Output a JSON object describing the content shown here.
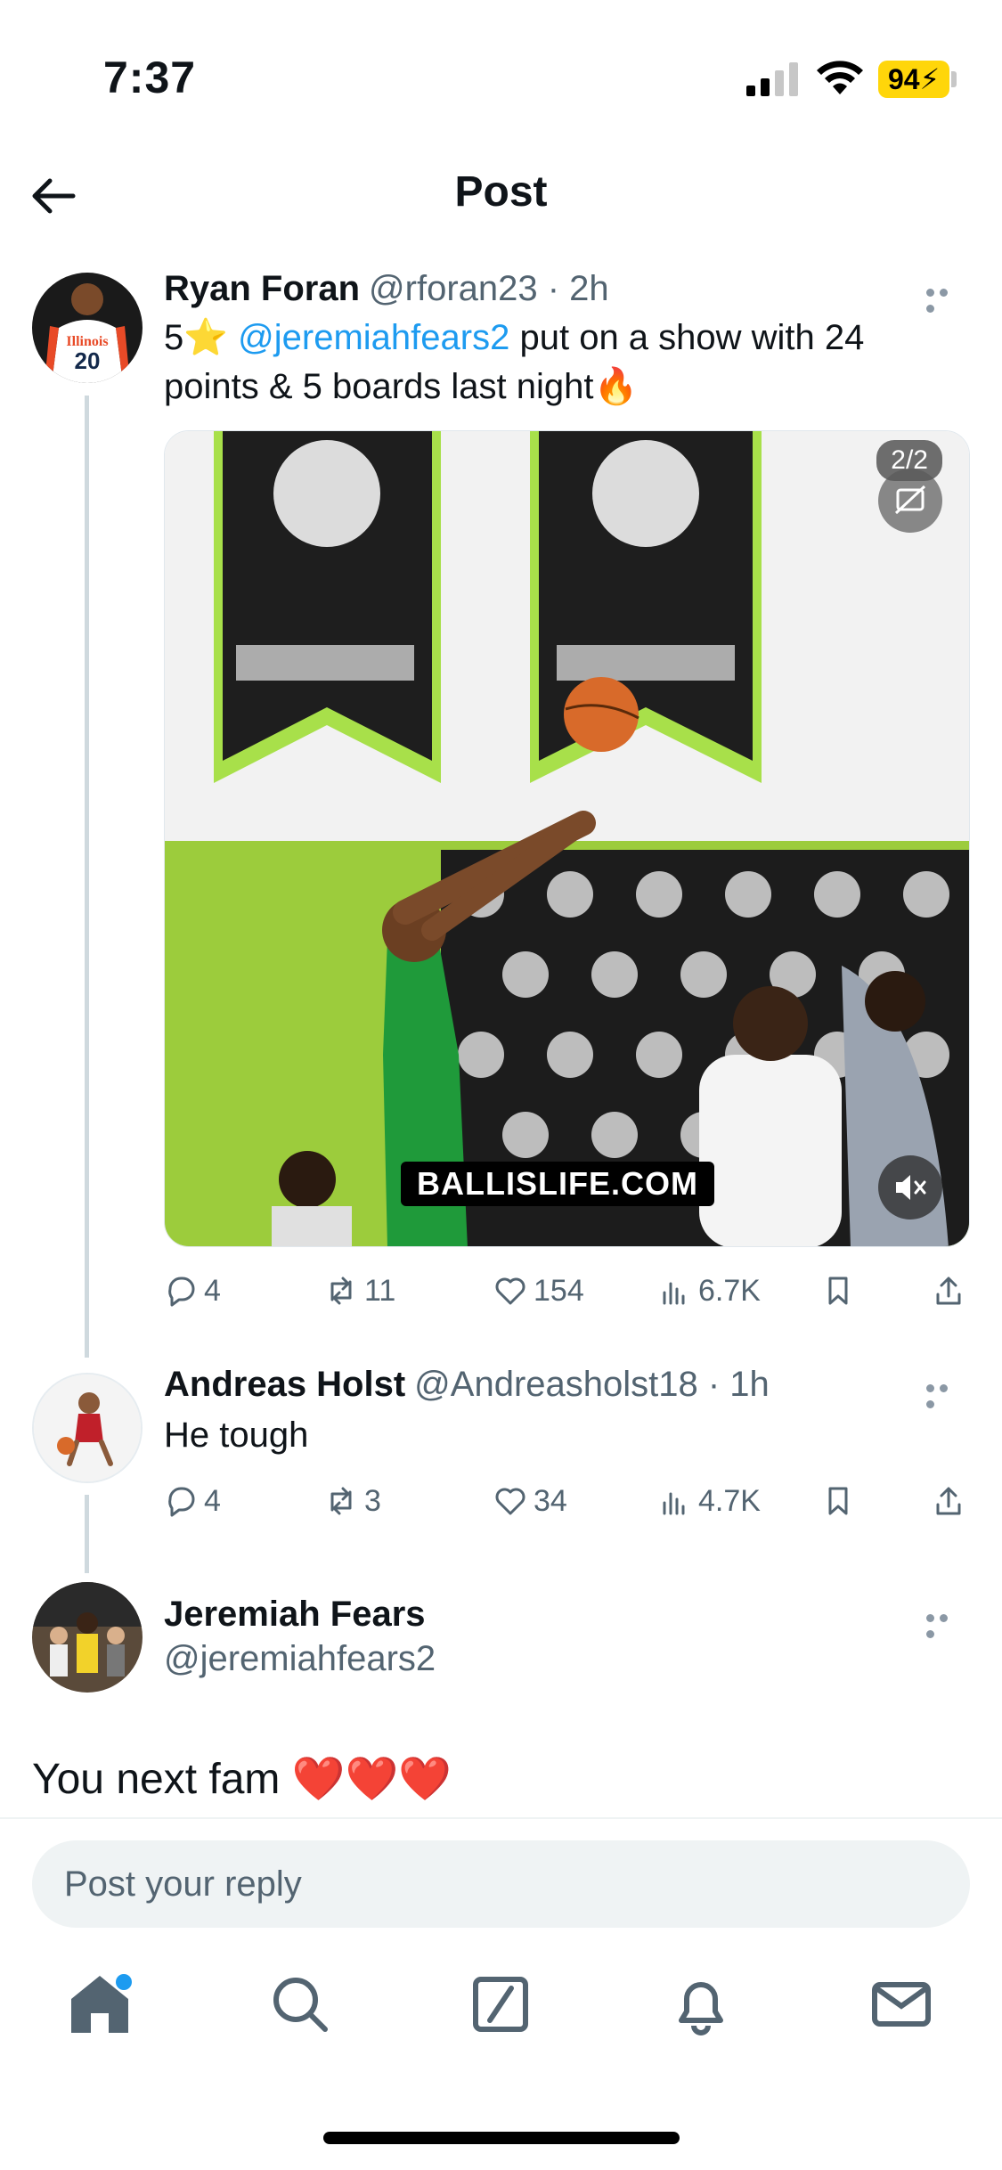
{
  "status_bar": {
    "time": "7:37",
    "battery": "94"
  },
  "header": {
    "title": "Post"
  },
  "tweets": [
    {
      "name": "Ryan Foran",
      "handle": "@rforan23 · 2h",
      "text_prefix": "5⭐ ",
      "mention": "@jeremiahfears2",
      "text_suffix": " put on a show with 24 points & 5 boards last night🔥",
      "media": {
        "counter": "2/2",
        "watermark": "BALLISLIFE.COM"
      },
      "stats": {
        "replies": "4",
        "reposts": "11",
        "likes": "154",
        "views": "6.7K"
      }
    },
    {
      "name": "Andreas Holst",
      "handle": "@Andreasholst18 · 1h",
      "text": "He tough",
      "stats": {
        "replies": "4",
        "reposts": "3",
        "likes": "34",
        "views": "4.7K"
      }
    },
    {
      "name": "Jeremiah Fears",
      "handle": "@jeremiahfears2",
      "text": "You next fam ❤️❤️❤️"
    }
  ],
  "reply": {
    "placeholder": "Post your reply"
  },
  "colors": {
    "accent": "#1d9bf0",
    "battery": "#ffd60a",
    "court_green": "#9ccc3c"
  },
  "icons": [
    "back-arrow-icon",
    "more-icon",
    "reply-icon",
    "repost-icon",
    "like-icon",
    "views-icon",
    "bookmark-icon",
    "share-icon",
    "cc-icon",
    "mute-icon",
    "home-icon",
    "search-icon",
    "grok-icon",
    "notifications-icon",
    "messages-icon"
  ]
}
